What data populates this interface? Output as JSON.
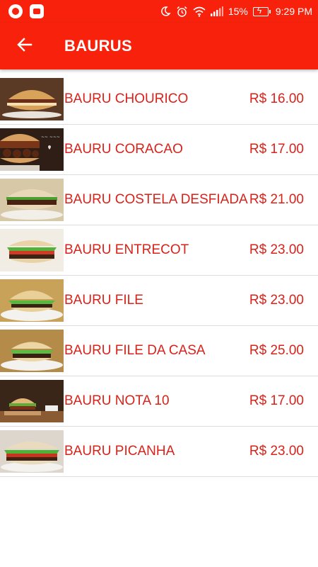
{
  "status_bar": {
    "battery_percent": "15%",
    "time": "9:29 PM",
    "icons": [
      "notification-app-icon",
      "mi-app-icon",
      "do-not-disturb-icon",
      "alarm-icon",
      "wifi-icon",
      "signal-icon",
      "battery-charging-icon"
    ]
  },
  "app_bar": {
    "back_icon": "arrow-back-icon",
    "title": "BAURUS"
  },
  "colors": {
    "primary": "#f8220c",
    "item_text": "#d8221a"
  },
  "items": [
    {
      "name": "BAURU CHOURICO",
      "price": "R$ 16.00"
    },
    {
      "name": "BAURU CORACAO",
      "price": "R$ 17.00"
    },
    {
      "name": "BAURU COSTELA DESFIADA",
      "price": "R$ 21.00"
    },
    {
      "name": "BAURU ENTRECOT",
      "price": "R$ 23.00"
    },
    {
      "name": "BAURU FILE",
      "price": "R$ 23.00"
    },
    {
      "name": "BAURU FILE DA CASA",
      "price": "R$ 25.00"
    },
    {
      "name": "BAURU NOTA 10",
      "price": "R$ 17.00"
    },
    {
      "name": "BAURU PICANHA",
      "price": "R$ 23.00"
    }
  ]
}
